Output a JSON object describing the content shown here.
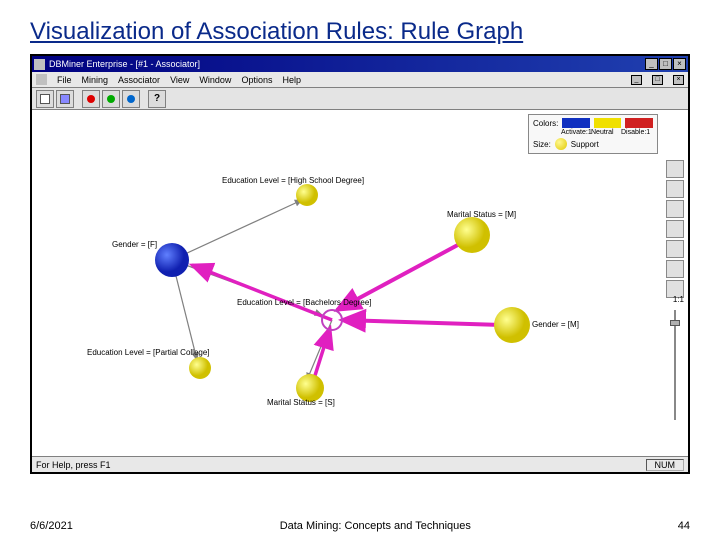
{
  "slide_title": "Visualization of Association Rules: Rule Graph",
  "title_bar": {
    "text": "DBMiner Enterprise - [#1 - Associator]"
  },
  "menu": {
    "file": "File",
    "mining": "Mining",
    "associator": "Associator",
    "view": "View",
    "window": "Window",
    "options": "Options",
    "help": "Help"
  },
  "legend": {
    "colors_label": "Colors:",
    "activate": "Activate:1",
    "neutral": "Neutral",
    "disable": "Disable:1",
    "size_label": "Size:",
    "support": "Support"
  },
  "nodes": {
    "edu_hs": "Education Level = [High School Degree]",
    "gender_f": "Gender = [F]",
    "edu_bach": "Education Level = [Bachelors Degree]",
    "marital_m": "Marital Status = [M]",
    "gender_m": "Gender = [M]",
    "edu_partial": "Education Level = [Partial College]",
    "marital_s": "Marital Status = [S]"
  },
  "status": {
    "left": "For Help, press F1",
    "right": "NUM"
  },
  "slider_label": "1:1",
  "footer": {
    "date": "6/6/2021",
    "center": "Data Mining: Concepts and Techniques",
    "page": "44"
  }
}
